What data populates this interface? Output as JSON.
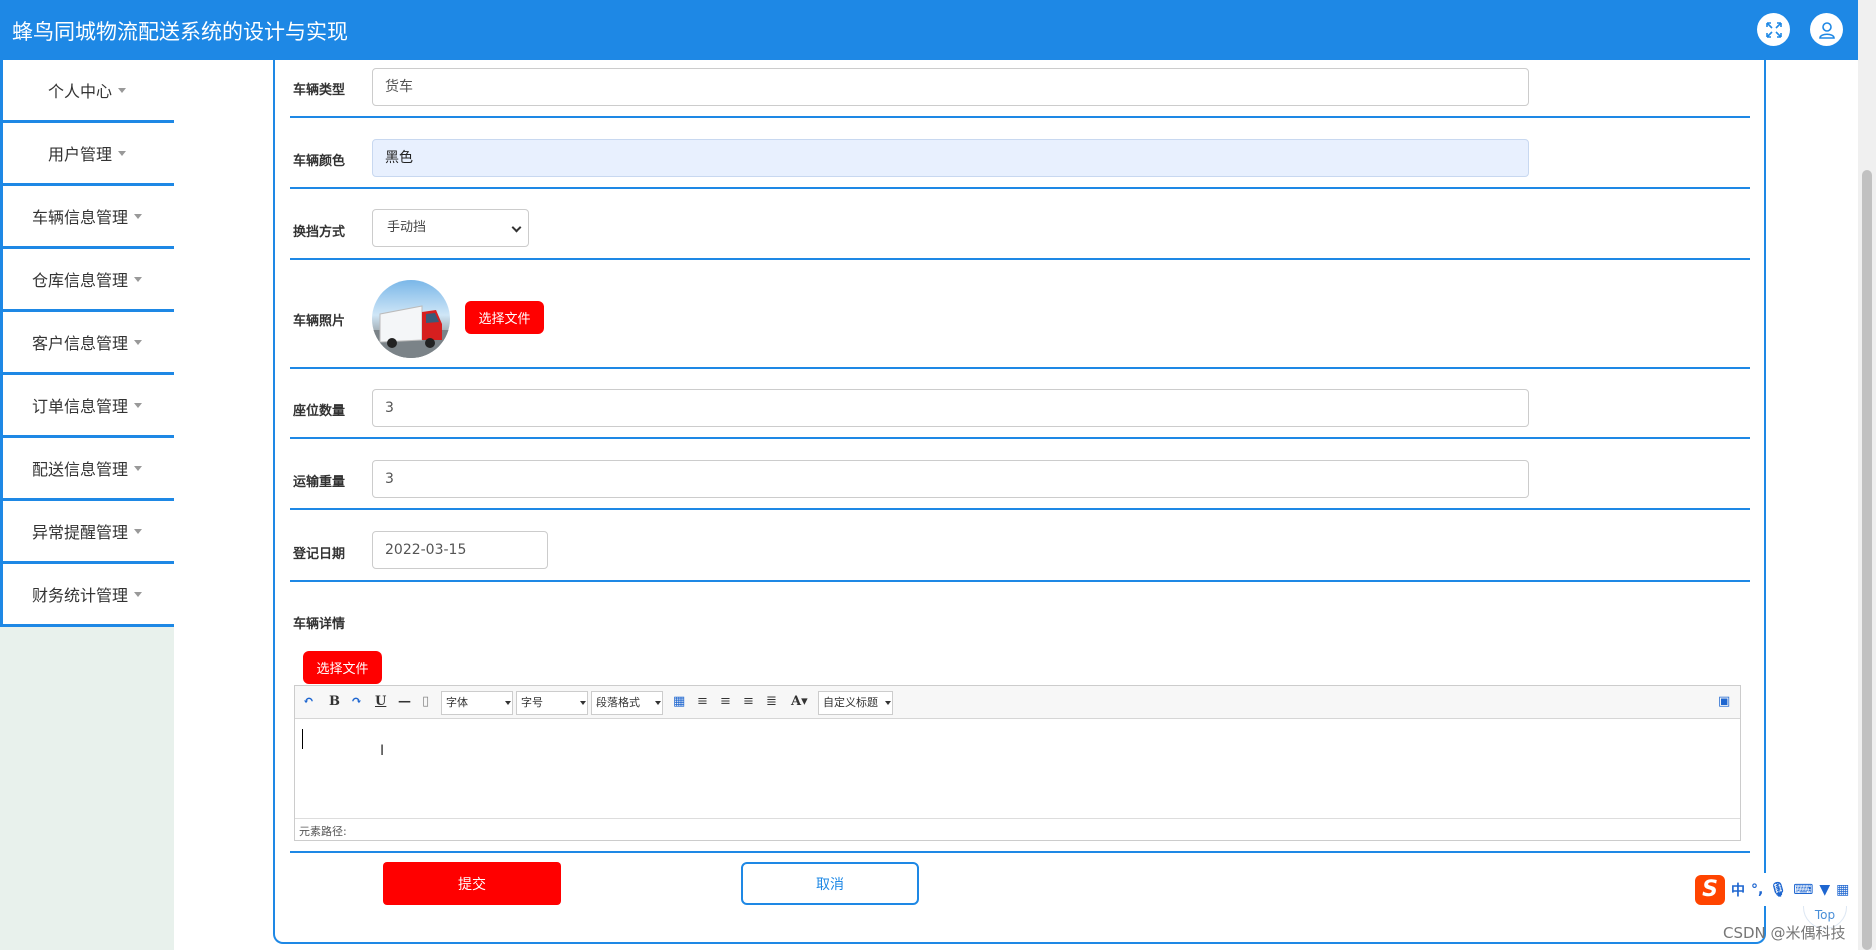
{
  "header": {
    "title": "蜂鸟同城物流配送系统的设计与实现",
    "icons": [
      "fullscreen-icon",
      "user-icon"
    ]
  },
  "sidebar": {
    "items": [
      {
        "label": "个人中心"
      },
      {
        "label": "用户管理"
      },
      {
        "label": "车辆信息管理"
      },
      {
        "label": "仓库信息管理"
      },
      {
        "label": "客户信息管理"
      },
      {
        "label": "订单信息管理"
      },
      {
        "label": "配送信息管理"
      },
      {
        "label": "异常提醒管理"
      },
      {
        "label": "财务统计管理"
      }
    ]
  },
  "form": {
    "vehicle_type": {
      "label": "车辆类型",
      "value": "货车"
    },
    "vehicle_color": {
      "label": "车辆颜色",
      "value": "黑色"
    },
    "gear_type": {
      "label": "换挡方式",
      "value": "手动挡"
    },
    "vehicle_photo": {
      "label": "车辆照片",
      "button": "选择文件"
    },
    "seats": {
      "label": "座位数量",
      "value": "3"
    },
    "load_weight": {
      "label": "运输重量",
      "value": "3"
    },
    "register_date": {
      "label": "登记日期",
      "value": "2022-03-15"
    },
    "details": {
      "label": "车辆详情",
      "upload_button": "选择文件",
      "toolbar": {
        "font_family": "字体",
        "font_size": "字号",
        "paragraph": "段落格式",
        "custom_title": "自定义标题"
      },
      "footer_path": "元素路径:"
    },
    "submit_label": "提交",
    "cancel_label": "取消"
  },
  "floating": {
    "ime": [
      "中",
      "°,"
    ],
    "top_label": "Top",
    "watermark": "CSDN @米偶科技"
  },
  "colors": {
    "accent": "#1e88e5",
    "danger": "#ff0000"
  }
}
